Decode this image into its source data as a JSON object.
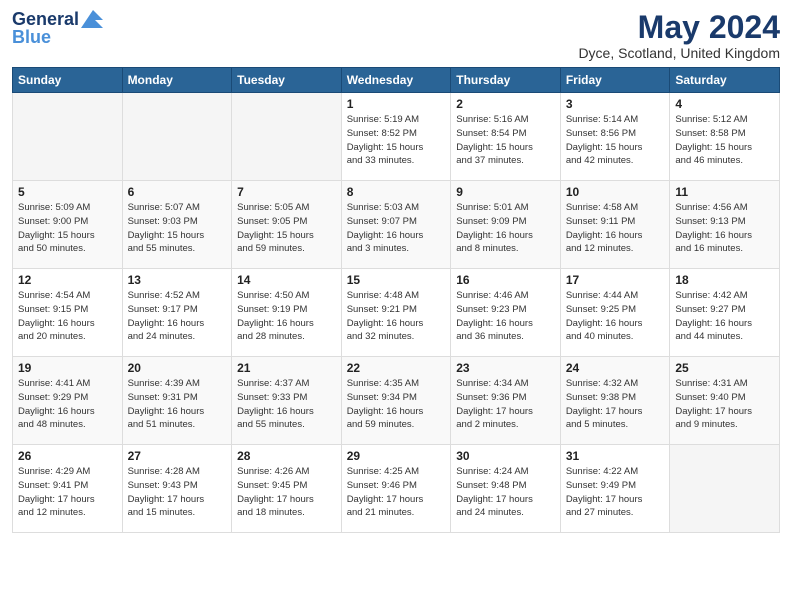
{
  "header": {
    "logo_line1": "General",
    "logo_line2": "Blue",
    "title": "May 2024",
    "subtitle": "Dyce, Scotland, United Kingdom"
  },
  "weekdays": [
    "Sunday",
    "Monday",
    "Tuesday",
    "Wednesday",
    "Thursday",
    "Friday",
    "Saturday"
  ],
  "weeks": [
    [
      {
        "day": "",
        "info": "",
        "empty": true
      },
      {
        "day": "",
        "info": "",
        "empty": true
      },
      {
        "day": "",
        "info": "",
        "empty": true
      },
      {
        "day": "1",
        "info": "Sunrise: 5:19 AM\nSunset: 8:52 PM\nDaylight: 15 hours\nand 33 minutes.",
        "empty": false
      },
      {
        "day": "2",
        "info": "Sunrise: 5:16 AM\nSunset: 8:54 PM\nDaylight: 15 hours\nand 37 minutes.",
        "empty": false
      },
      {
        "day": "3",
        "info": "Sunrise: 5:14 AM\nSunset: 8:56 PM\nDaylight: 15 hours\nand 42 minutes.",
        "empty": false
      },
      {
        "day": "4",
        "info": "Sunrise: 5:12 AM\nSunset: 8:58 PM\nDaylight: 15 hours\nand 46 minutes.",
        "empty": false
      }
    ],
    [
      {
        "day": "5",
        "info": "Sunrise: 5:09 AM\nSunset: 9:00 PM\nDaylight: 15 hours\nand 50 minutes.",
        "empty": false
      },
      {
        "day": "6",
        "info": "Sunrise: 5:07 AM\nSunset: 9:03 PM\nDaylight: 15 hours\nand 55 minutes.",
        "empty": false
      },
      {
        "day": "7",
        "info": "Sunrise: 5:05 AM\nSunset: 9:05 PM\nDaylight: 15 hours\nand 59 minutes.",
        "empty": false
      },
      {
        "day": "8",
        "info": "Sunrise: 5:03 AM\nSunset: 9:07 PM\nDaylight: 16 hours\nand 3 minutes.",
        "empty": false
      },
      {
        "day": "9",
        "info": "Sunrise: 5:01 AM\nSunset: 9:09 PM\nDaylight: 16 hours\nand 8 minutes.",
        "empty": false
      },
      {
        "day": "10",
        "info": "Sunrise: 4:58 AM\nSunset: 9:11 PM\nDaylight: 16 hours\nand 12 minutes.",
        "empty": false
      },
      {
        "day": "11",
        "info": "Sunrise: 4:56 AM\nSunset: 9:13 PM\nDaylight: 16 hours\nand 16 minutes.",
        "empty": false
      }
    ],
    [
      {
        "day": "12",
        "info": "Sunrise: 4:54 AM\nSunset: 9:15 PM\nDaylight: 16 hours\nand 20 minutes.",
        "empty": false
      },
      {
        "day": "13",
        "info": "Sunrise: 4:52 AM\nSunset: 9:17 PM\nDaylight: 16 hours\nand 24 minutes.",
        "empty": false
      },
      {
        "day": "14",
        "info": "Sunrise: 4:50 AM\nSunset: 9:19 PM\nDaylight: 16 hours\nand 28 minutes.",
        "empty": false
      },
      {
        "day": "15",
        "info": "Sunrise: 4:48 AM\nSunset: 9:21 PM\nDaylight: 16 hours\nand 32 minutes.",
        "empty": false
      },
      {
        "day": "16",
        "info": "Sunrise: 4:46 AM\nSunset: 9:23 PM\nDaylight: 16 hours\nand 36 minutes.",
        "empty": false
      },
      {
        "day": "17",
        "info": "Sunrise: 4:44 AM\nSunset: 9:25 PM\nDaylight: 16 hours\nand 40 minutes.",
        "empty": false
      },
      {
        "day": "18",
        "info": "Sunrise: 4:42 AM\nSunset: 9:27 PM\nDaylight: 16 hours\nand 44 minutes.",
        "empty": false
      }
    ],
    [
      {
        "day": "19",
        "info": "Sunrise: 4:41 AM\nSunset: 9:29 PM\nDaylight: 16 hours\nand 48 minutes.",
        "empty": false
      },
      {
        "day": "20",
        "info": "Sunrise: 4:39 AM\nSunset: 9:31 PM\nDaylight: 16 hours\nand 51 minutes.",
        "empty": false
      },
      {
        "day": "21",
        "info": "Sunrise: 4:37 AM\nSunset: 9:33 PM\nDaylight: 16 hours\nand 55 minutes.",
        "empty": false
      },
      {
        "day": "22",
        "info": "Sunrise: 4:35 AM\nSunset: 9:34 PM\nDaylight: 16 hours\nand 59 minutes.",
        "empty": false
      },
      {
        "day": "23",
        "info": "Sunrise: 4:34 AM\nSunset: 9:36 PM\nDaylight: 17 hours\nand 2 minutes.",
        "empty": false
      },
      {
        "day": "24",
        "info": "Sunrise: 4:32 AM\nSunset: 9:38 PM\nDaylight: 17 hours\nand 5 minutes.",
        "empty": false
      },
      {
        "day": "25",
        "info": "Sunrise: 4:31 AM\nSunset: 9:40 PM\nDaylight: 17 hours\nand 9 minutes.",
        "empty": false
      }
    ],
    [
      {
        "day": "26",
        "info": "Sunrise: 4:29 AM\nSunset: 9:41 PM\nDaylight: 17 hours\nand 12 minutes.",
        "empty": false
      },
      {
        "day": "27",
        "info": "Sunrise: 4:28 AM\nSunset: 9:43 PM\nDaylight: 17 hours\nand 15 minutes.",
        "empty": false
      },
      {
        "day": "28",
        "info": "Sunrise: 4:26 AM\nSunset: 9:45 PM\nDaylight: 17 hours\nand 18 minutes.",
        "empty": false
      },
      {
        "day": "29",
        "info": "Sunrise: 4:25 AM\nSunset: 9:46 PM\nDaylight: 17 hours\nand 21 minutes.",
        "empty": false
      },
      {
        "day": "30",
        "info": "Sunrise: 4:24 AM\nSunset: 9:48 PM\nDaylight: 17 hours\nand 24 minutes.",
        "empty": false
      },
      {
        "day": "31",
        "info": "Sunrise: 4:22 AM\nSunset: 9:49 PM\nDaylight: 17 hours\nand 27 minutes.",
        "empty": false
      },
      {
        "day": "",
        "info": "",
        "empty": true
      }
    ]
  ]
}
